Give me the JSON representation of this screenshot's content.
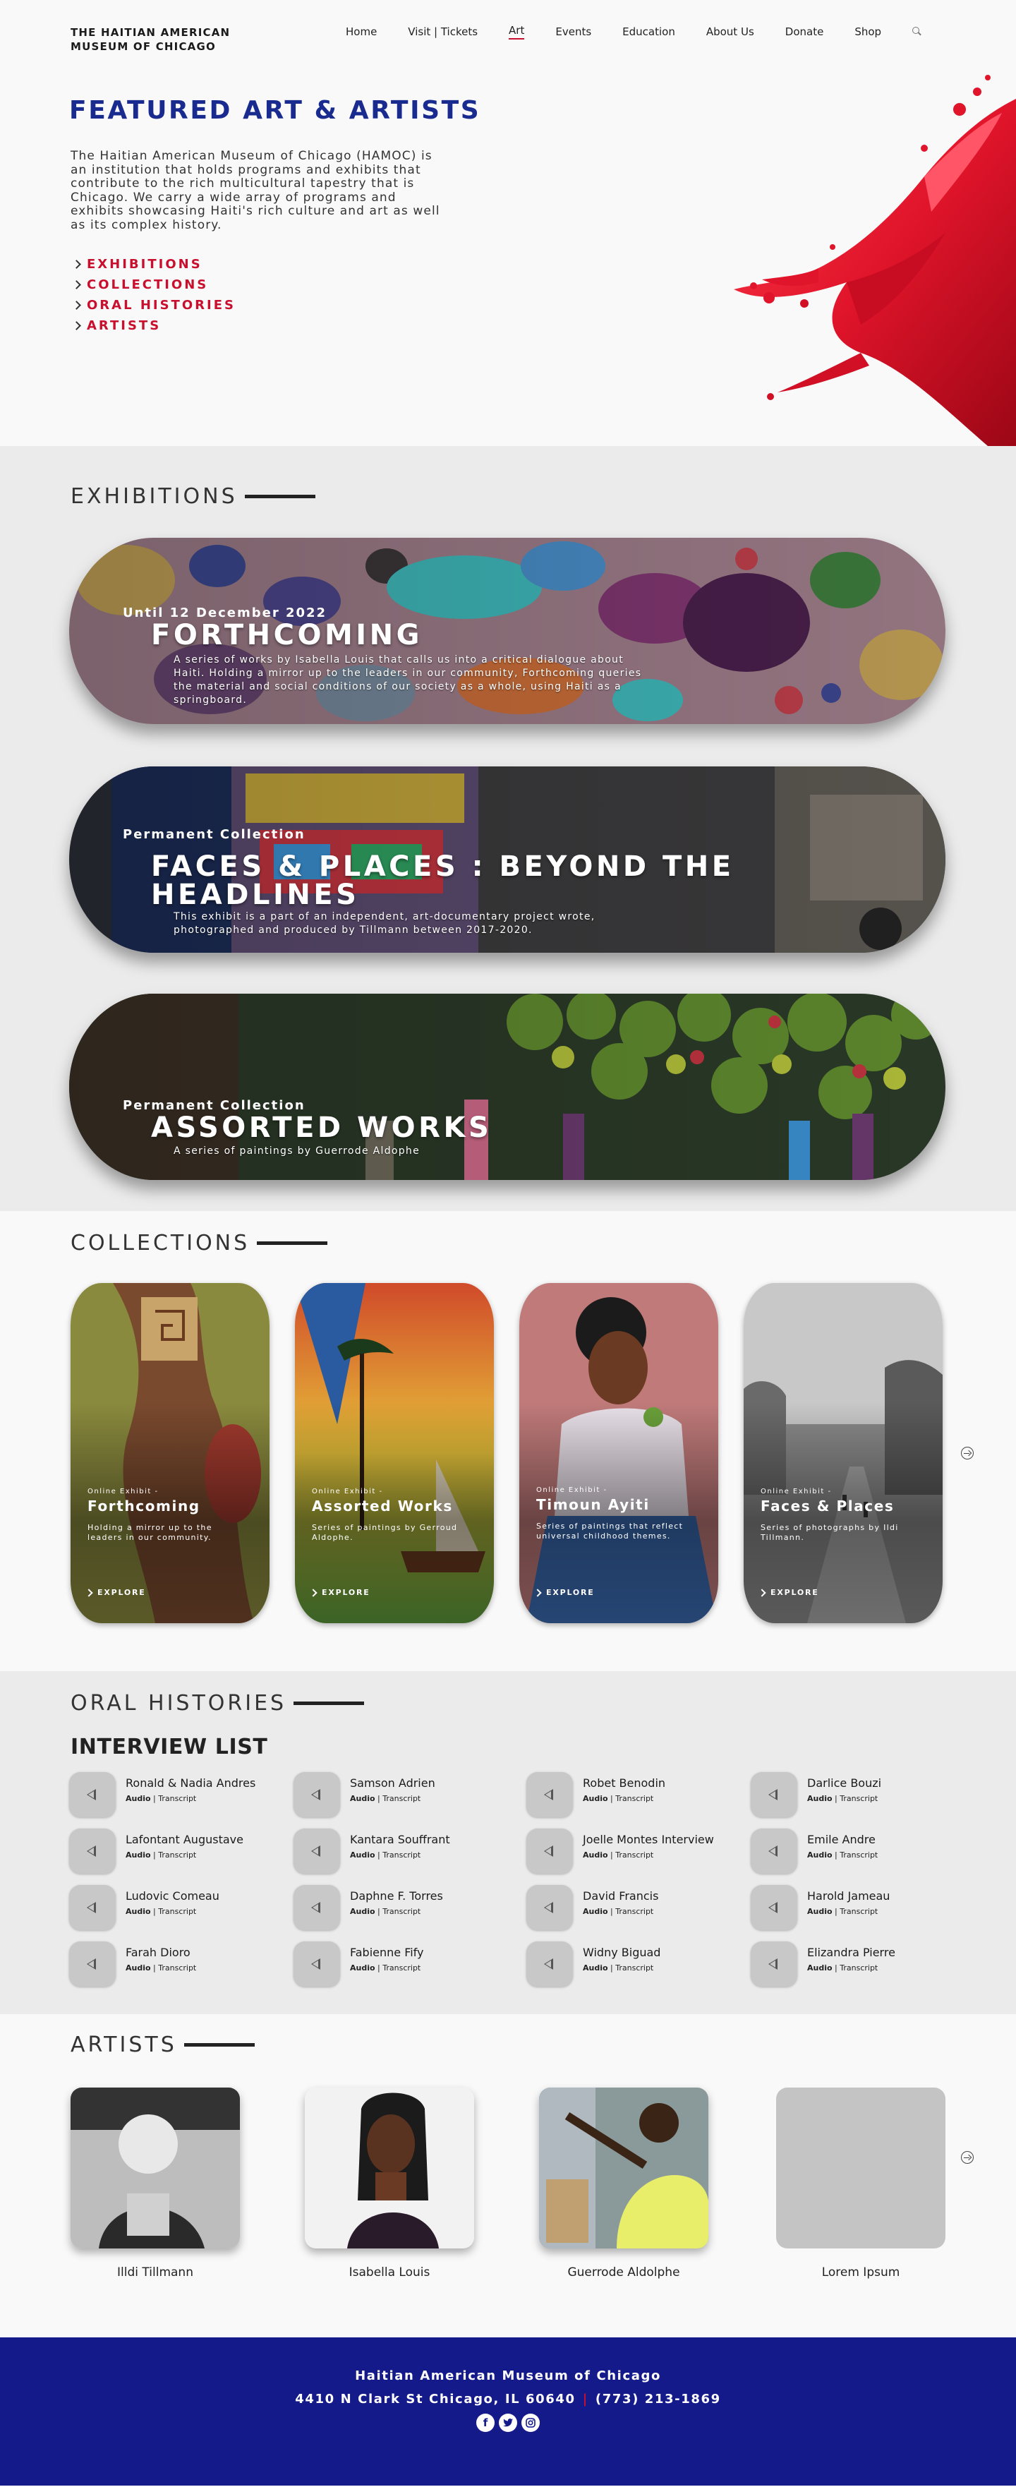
{
  "header": {
    "logo": "THE HAITIAN AMERICAN MUSEUM OF CHICAGO",
    "nav": [
      "Home",
      "Visit | Tickets",
      "Art",
      "Events",
      "Education",
      "About Us",
      "Donate",
      "Shop"
    ],
    "active_nav": "Art",
    "search_icon": "search-icon"
  },
  "hero": {
    "title": "FEATURED ART & ARTISTS",
    "description": "The Haitian American Museum of Chicago (HAMOC) is an institution that holds programs and exhibits that contribute to the rich multicultural tapestry that is Chicago. We carry a wide array of programs and exhibits showcasing Haiti's rich culture and art as well as its complex history.",
    "links": [
      "EXHIBITIONS",
      "COLLECTIONS",
      "ORAL HISTORIES",
      "ARTISTS"
    ],
    "accent": "#c8102e",
    "title_color": "#1a2b8f"
  },
  "exhibitions": {
    "heading": "EXHIBITIONS",
    "items": [
      {
        "kicker": "Until 12 December 2022",
        "title": "FORTHCOMING",
        "description": "A series of works by Isabella Louis that calls us into a critical dialogue about Haiti. Holding a mirror up to the leaders in our community, Forthcoming queries the material and social conditions of our society as a whole, using Haiti as a springboard."
      },
      {
        "kicker": "Permanent Collection",
        "title": "FACES & PLACES : BEYOND THE HEADLINES",
        "description": "This exhibit is a part of an independent, art-documentary project wrote, photographed and produced by Tillmann between 2017-2020."
      },
      {
        "kicker": "Permanent Collection",
        "title": "ASSORTED WORKS",
        "description": "A series of paintings by Guerrode Aldophe"
      }
    ]
  },
  "collections": {
    "heading": "COLLECTIONS",
    "items": [
      {
        "kicker": "Online Exhibit -",
        "title": "Forthcoming",
        "description": "Holding a mirror up to the leaders in our community.",
        "cta": "EXPLORE"
      },
      {
        "kicker": "Online Exhibit -",
        "title": "Assorted Works",
        "description": "Series of paintings by Gerroud Aldophe.",
        "cta": "EXPLORE"
      },
      {
        "kicker": "Online Exhibit -",
        "title": "Timoun Ayiti",
        "description": "Series of paintings that reflect universal childhood themes.",
        "cta": "EXPLORE"
      },
      {
        "kicker": "Online Exhibit -",
        "title": "Faces & Places",
        "description": "Series of photographs by Ildi Tillmann.",
        "cta": "EXPLORE"
      }
    ]
  },
  "oral_histories": {
    "heading": "ORAL HISTORIES",
    "subheading": "INTERVIEW LIST",
    "audio_label": "Audio",
    "transcript_label": "Transcript",
    "interviews": [
      "Ronald & Nadia Andres",
      "Samson Adrien",
      "Robet Benodin",
      "Darlice Bouzi",
      "Lafontant Augustave",
      "Kantara Souffrant",
      "Joelle Montes Interview",
      "Emile Andre",
      "Ludovic Comeau",
      "Daphne F. Torres",
      "David Francis",
      "Harold Jameau",
      "Farah Dioro",
      "Fabienne Fify",
      "Widny Biguad",
      "Elizandra Pierre"
    ]
  },
  "artists": {
    "heading": "ARTISTS",
    "names": [
      "Illdi Tillmann",
      "Isabella Louis",
      "Guerrode Aldolphe",
      "Lorem Ipsum"
    ]
  },
  "footer": {
    "name": "Haitian American Museum of Chicago",
    "address": "4410 N Clark St  Chicago, IL 60640",
    "separator": "|",
    "phone": "(773) 213-1869",
    "socials": [
      "facebook-icon",
      "twitter-icon",
      "instagram-icon"
    ],
    "bg": "#141a8a"
  }
}
